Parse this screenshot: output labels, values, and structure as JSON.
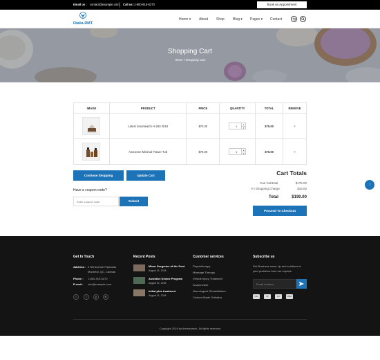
{
  "topbar": {
    "email_label": "Email us :",
    "email": "contact@example.com",
    "call_label": "Call us :",
    "phone": "1-800-915-6270",
    "book_button": "Book an Appointment"
  },
  "header": {
    "logo_text": "Dialia RMT",
    "nav": [
      "Home",
      "About",
      "Shop",
      "Blog",
      "Pages",
      "Contact"
    ]
  },
  "hero": {
    "title": "Shopping Cart",
    "breadcrumb": [
      "Home",
      "/",
      "Shopping Cart"
    ]
  },
  "cart": {
    "headers": [
      "IMAGE",
      "PRODUCT",
      "PRICE",
      "QUANTITY",
      "TOTAL",
      "REMOVE"
    ],
    "rows": [
      {
        "product": "Latest Smartwatch H-250 2018",
        "price": "$75.00",
        "qty": "1",
        "total": "$75.00",
        "remove": "×"
      },
      {
        "product": "Awesome Minimal Flower Tub",
        "price": "$75.00",
        "qty": "1",
        "total": "$75.00",
        "remove": "×"
      }
    ]
  },
  "actions": {
    "continue": "Continue Shopping",
    "update": "Update Cart",
    "coupon_label": "Have a coupon code?",
    "coupon_placeholder": "Enter coupon code",
    "submit": "Submit"
  },
  "totals": {
    "title": "Cart Totals",
    "subtotal_label": "Cart Subtotal",
    "subtotal": "$175.00",
    "shipping_label": "(+) Shopping Charge",
    "shipping": "$15.00",
    "total_label": "Total",
    "total": "$190.00",
    "checkout": "Proceed To Checkout"
  },
  "footer": {
    "col1": {
      "title": "Get In Touch",
      "address_label": "Address :",
      "address1": "2726 Avenue Papineau",
      "address2": "Montreal, QC, Canada",
      "phone_label": "Phone :",
      "phone": "1-800-915-6270",
      "email_label": "E-mail :",
      "email": "info@example.com",
      "social": [
        "t",
        "f",
        "p",
        "in"
      ]
    },
    "col2": {
      "title": "Recent Posts",
      "posts": [
        {
          "title": "Minor Surgeries of the Foot",
          "date": "August 01, 2018"
        },
        {
          "title": "Assistive Device Program",
          "date": "August 01, 2018"
        },
        {
          "title": "Initial plus treatment",
          "date": "August 01, 2018"
        }
      ]
    },
    "col3": {
      "title": "Customer services",
      "links": [
        "Physiotherapy",
        "Massage Therapy",
        "Vehicle Injury Treatment",
        "Acupuncture",
        "Neurological Rehabilitation",
        "Custom-Made Orthotics"
      ]
    },
    "col4": {
      "title": "Subscribe us",
      "text1": "Get Business news, tip and solutions to",
      "text2": "your problems from our experts.",
      "placeholder": "Email address",
      "payments": [
        "VISA",
        "PP",
        "MC",
        "AMEX"
      ]
    },
    "copyright": "Copyright 2019 by themenarch. All rights reserved"
  },
  "colors": {
    "accent": "#1d73b7",
    "footer_bg": "#141414",
    "topbar_bg": "#000000"
  }
}
